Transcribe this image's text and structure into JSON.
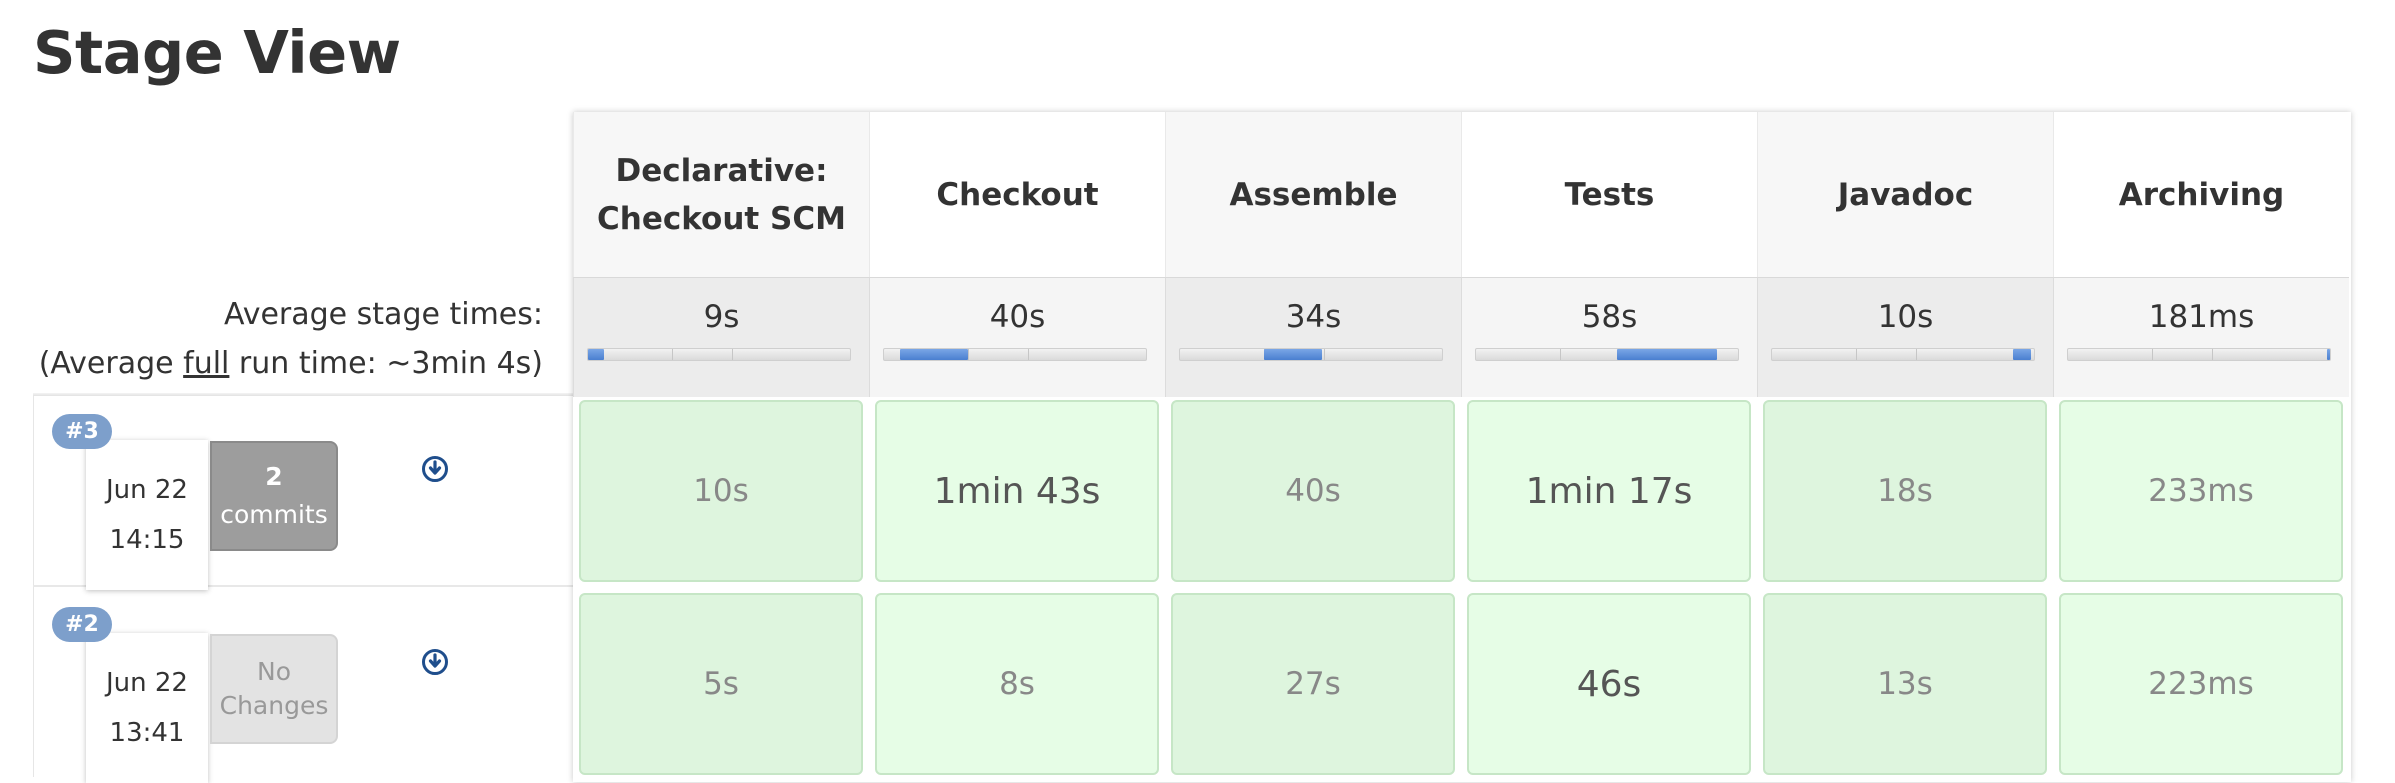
{
  "page_title": "Stage View",
  "average_stage_times_label": "Average stage times:",
  "average_full_run": {
    "prefix": "(Average ",
    "link": "full",
    "suffix": " run time: ~3min 4s)"
  },
  "stages": [
    {
      "name": "Declarative: Checkout SCM",
      "name_lines": [
        "Declarative:",
        "Checkout SCM"
      ],
      "avg": "9s",
      "bar_fill": {
        "start": 0.0,
        "width": 0.06
      }
    },
    {
      "name": "Checkout",
      "name_lines": [
        "Checkout"
      ],
      "avg": "40s",
      "bar_fill": {
        "start": 0.06,
        "width": 0.26
      }
    },
    {
      "name": "Assemble",
      "name_lines": [
        "Assemble"
      ],
      "avg": "34s",
      "bar_fill": {
        "start": 0.32,
        "width": 0.22
      }
    },
    {
      "name": "Tests",
      "name_lines": [
        "Tests"
      ],
      "avg": "58s",
      "bar_fill": {
        "start": 0.54,
        "width": 0.38
      }
    },
    {
      "name": "Javadoc",
      "name_lines": [
        "Javadoc"
      ],
      "avg": "10s",
      "bar_fill": {
        "start": 0.92,
        "width": 0.07
      }
    },
    {
      "name": "Archiving",
      "name_lines": [
        "Archiving"
      ],
      "avg": "181ms",
      "bar_fill": {
        "start": 0.99,
        "width": 0.01
      }
    }
  ],
  "builds": [
    {
      "number": "#3",
      "date": "Jun 22",
      "time": "14:15",
      "changes": {
        "type": "commits",
        "count": "2",
        "label": "commits"
      },
      "durations": [
        "10s",
        "1min 43s",
        "40s",
        "1min 17s",
        "18s",
        "233ms"
      ],
      "emphasis": [
        false,
        true,
        false,
        true,
        false,
        false
      ]
    },
    {
      "number": "#2",
      "date": "Jun 22",
      "time": "13:41",
      "changes": {
        "type": "none",
        "line1": "No",
        "line2": "Changes"
      },
      "durations": [
        "5s",
        "8s",
        "27s",
        "46s",
        "13s",
        "223ms"
      ],
      "emphasis": [
        false,
        false,
        false,
        true,
        false,
        false
      ]
    }
  ],
  "icons": {
    "download": "download-circle-icon"
  },
  "colors": {
    "success_cell": "#e6fde6",
    "success_border": "#c6e6c6",
    "badge": "#7d9fcb",
    "bar_fill": "#4a7fd0",
    "commits_badge": "#9d9d9d"
  }
}
